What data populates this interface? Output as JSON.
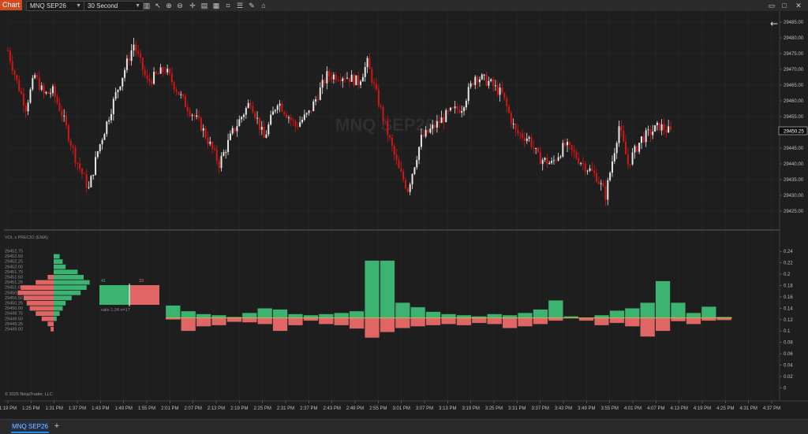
{
  "toolbar": {
    "badge": "Chart",
    "instrument": "MNQ SEP26",
    "interval": "30 Second",
    "tools": [
      "bars-icon",
      "cursor-icon",
      "pencil-icon",
      "zoom-in-icon",
      "zoom-out-icon",
      "crosshair-icon",
      "data-box-icon",
      "properties-icon",
      "indicators-icon",
      "strategies-icon",
      "drawing-tools-icon",
      "alerts-icon",
      "share-icon"
    ],
    "window": [
      "minimize-icon",
      "maximize-icon",
      "close-icon"
    ]
  },
  "colors": {
    "background": "#1e1e1e",
    "up": "#e8e8e8",
    "down": "#d41616",
    "buy": "#3cb371",
    "sell": "#e06666",
    "grid": "#2a2a2a"
  },
  "price_panel": {
    "watermark": "MNQ SEP26",
    "current_price": "29450.25",
    "y_labels": [
      "29485.00",
      "29480.00",
      "29475.00",
      "29470.00",
      "29465.00",
      "29460.00",
      "29455.00",
      "29450.00",
      "29445.00",
      "29440.00",
      "29435.00",
      "29430.00",
      "29425.00"
    ],
    "y_range": [
      29421,
      29487
    ],
    "back_arrow": "←"
  },
  "volume_panel": {
    "indicator_label": "VOL x PRECIO (EMA)",
    "profile_prices": [
      "29452.75",
      "29452.50",
      "29452.25",
      "29452.00",
      "29451.75",
      "29451.50",
      "29451.25",
      "29451.00",
      "29450.75",
      "29450.50",
      "29450.25",
      "29450.00",
      "29449.75",
      "29449.50",
      "29449.25",
      "29449.00"
    ],
    "profile_buy": [
      0,
      0.2,
      0.3,
      0.4,
      0.8,
      1.0,
      1.2,
      1.1,
      0.9,
      0.6,
      0.4,
      0.3,
      0.2,
      0.1,
      0,
      0
    ],
    "profile_sell": [
      0,
      0,
      0,
      0,
      0,
      0.2,
      0.6,
      1.1,
      1.2,
      1.0,
      0.9,
      0.8,
      0.6,
      0.4,
      0.2,
      0.1
    ],
    "summary_buy": "41",
    "summary_sell": "33",
    "summary_ratio": "ratio 1.24   n=17",
    "y_labels": [
      "0.24",
      "0.22",
      "0.2",
      "0.18",
      "0.16",
      "0.14",
      "0.12",
      "0.1",
      "0.08",
      "0.06",
      "0.04",
      "0.02",
      "0"
    ],
    "y_range": [
      -0.005,
      0.25
    ],
    "copyright": "© 2026 NinjaTrader, LLC"
  },
  "x_axis": [
    "1:19 PM",
    "1:25 PM",
    "1:31 PM",
    "1:37 PM",
    "1:43 PM",
    "1:49 PM",
    "1:55 PM",
    "2:01 PM",
    "2:07 PM",
    "2:13 PM",
    "2:19 PM",
    "2:25 PM",
    "2:31 PM",
    "2:37 PM",
    "2:43 PM",
    "2:49 PM",
    "2:55 PM",
    "3:01 PM",
    "3:07 PM",
    "3:13 PM",
    "3:19 PM",
    "3:25 PM",
    "3:31 PM",
    "3:37 PM",
    "3:43 PM",
    "3:49 PM",
    "3:55 PM",
    "4:01 PM",
    "4:07 PM",
    "4:13 PM",
    "4:19 PM",
    "4:25 PM",
    "4:31 PM",
    "4:37 PM"
  ],
  "chart_data": [
    {
      "type": "candlestick",
      "title": "MNQ SEP26",
      "price_path": [
        [
          0,
          29476
        ],
        [
          4,
          29466
        ],
        [
          8,
          29458
        ],
        [
          12,
          29468
        ],
        [
          16,
          29462
        ],
        [
          20,
          29463
        ],
        [
          24,
          29456
        ],
        [
          30,
          29442
        ],
        [
          36,
          29432
        ],
        [
          40,
          29444
        ],
        [
          48,
          29462
        ],
        [
          56,
          29478
        ],
        [
          62,
          29466
        ],
        [
          70,
          29470
        ],
        [
          78,
          29460
        ],
        [
          86,
          29452
        ],
        [
          94,
          29440
        ],
        [
          100,
          29450
        ],
        [
          108,
          29460
        ],
        [
          114,
          29448
        ],
        [
          120,
          29460
        ],
        [
          128,
          29452
        ],
        [
          134,
          29456
        ],
        [
          142,
          29468
        ],
        [
          150,
          29468
        ],
        [
          156,
          29466
        ],
        [
          160,
          29472
        ],
        [
          168,
          29452
        ],
        [
          174,
          29438
        ],
        [
          178,
          29432
        ],
        [
          184,
          29448
        ],
        [
          190,
          29452
        ],
        [
          196,
          29456
        ],
        [
          202,
          29458
        ],
        [
          208,
          29468
        ],
        [
          214,
          29466
        ],
        [
          220,
          29462
        ],
        [
          226,
          29450
        ],
        [
          232,
          29448
        ],
        [
          236,
          29442
        ],
        [
          242,
          29440
        ],
        [
          248,
          29446
        ],
        [
          256,
          29440
        ],
        [
          262,
          29436
        ],
        [
          266,
          29430
        ],
        [
          272,
          29452
        ],
        [
          276,
          29440
        ],
        [
          282,
          29448
        ],
        [
          290,
          29452
        ],
        [
          295,
          29450
        ]
      ],
      "volatility": 2.2
    },
    {
      "type": "bar",
      "title": "VOL x PRECIO (EMA)",
      "baseline": 0.123,
      "buy": [
        0.145,
        0.135,
        0.13,
        0.128,
        0.125,
        0.132,
        0.14,
        0.138,
        0.13,
        0.128,
        0.13,
        0.132,
        0.135,
        0.224,
        0.224,
        0.15,
        0.142,
        0.134,
        0.13,
        0.128,
        0.126,
        0.13,
        0.128,
        0.132,
        0.138,
        0.154,
        0.126,
        0.122,
        0.128,
        0.136,
        0.14,
        0.15,
        0.188,
        0.15,
        0.132,
        0.143,
        0.125
      ],
      "sell": [
        0.12,
        0.1,
        0.108,
        0.11,
        0.116,
        0.115,
        0.112,
        0.1,
        0.11,
        0.118,
        0.112,
        0.11,
        0.104,
        0.088,
        0.098,
        0.105,
        0.108,
        0.11,
        0.112,
        0.11,
        0.114,
        0.112,
        0.105,
        0.108,
        0.112,
        0.118,
        0.122,
        0.118,
        0.11,
        0.114,
        0.108,
        0.09,
        0.1,
        0.117,
        0.112,
        0.118,
        0.119
      ]
    }
  ]
}
